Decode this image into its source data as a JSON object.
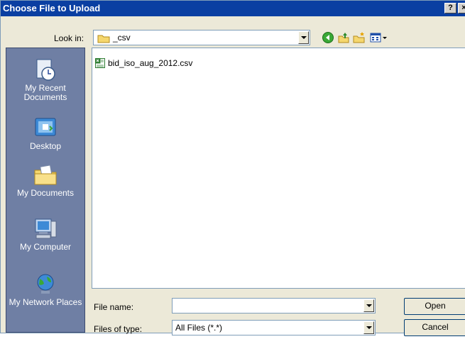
{
  "dialog": {
    "title": "Choose File to Upload",
    "help_label": "?",
    "close_label": "×"
  },
  "lookin": {
    "label": "Look in:",
    "value": "_csv"
  },
  "places": [
    {
      "label": "My Recent Documents"
    },
    {
      "label": "Desktop"
    },
    {
      "label": "My Documents"
    },
    {
      "label": "My Computer"
    },
    {
      "label": "My Network Places"
    }
  ],
  "files": [
    {
      "name": "bid_iso_aug_2012.csv"
    }
  ],
  "filename": {
    "label": "File name:",
    "value": ""
  },
  "filetype": {
    "label": "Files of type:",
    "value": "All Files (*.*)"
  },
  "buttons": {
    "open": "Open",
    "cancel": "Cancel"
  },
  "toolbar": [
    "back-icon",
    "up-folder-icon",
    "new-folder-icon",
    "views-menu-icon"
  ],
  "colors": {
    "titlebar": "#0a3fa2",
    "places_bar": "#6f7fa4",
    "dialog_bg": "#ece9d8"
  }
}
